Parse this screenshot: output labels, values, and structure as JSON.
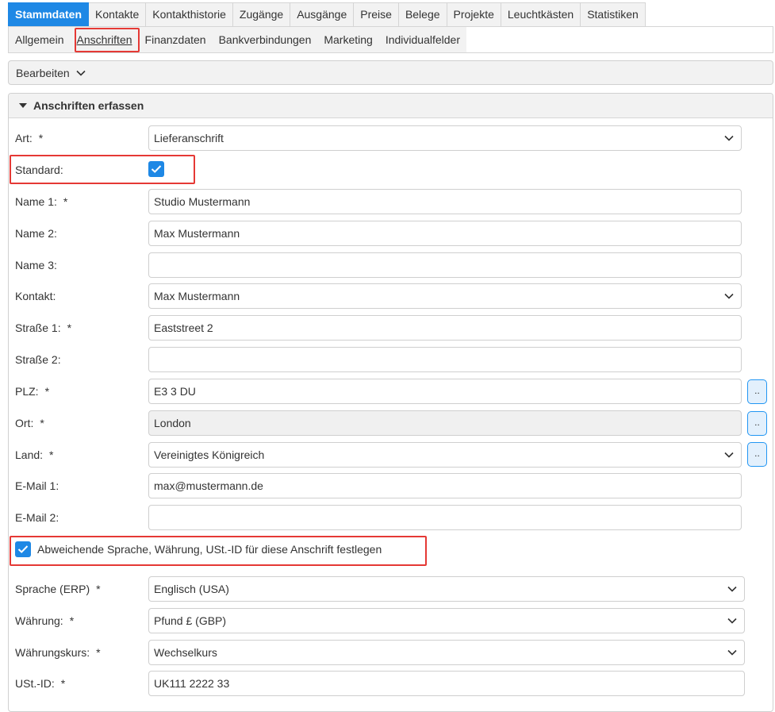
{
  "tabs_main": [
    "Stammdaten",
    "Kontakte",
    "Kontakthistorie",
    "Zugänge",
    "Ausgänge",
    "Preise",
    "Belege",
    "Projekte",
    "Leuchtkästen",
    "Statistiken"
  ],
  "tabs_sub": [
    "Allgemein",
    "Anschriften",
    "Finanzdaten",
    "Bankverbindungen",
    "Marketing",
    "Individualfelder"
  ],
  "edit_menu": {
    "label": "Bearbeiten"
  },
  "section": {
    "title": "Anschriften erfassen"
  },
  "required_mark": "*",
  "dots_label": "..",
  "form": {
    "art": {
      "label": "Art:",
      "value": "Lieferanschrift"
    },
    "standard": {
      "label": "Standard:",
      "checked": true
    },
    "name1": {
      "label": "Name 1:",
      "value": "Studio Mustermann"
    },
    "name2": {
      "label": "Name 2:",
      "value": "Max Mustermann"
    },
    "name3": {
      "label": "Name 3:",
      "value": ""
    },
    "kontakt": {
      "label": "Kontakt:",
      "value": "Max Mustermann"
    },
    "strasse1": {
      "label": "Straße 1:",
      "value": "Eaststreet 2"
    },
    "strasse2": {
      "label": "Straße 2:",
      "value": ""
    },
    "plz": {
      "label": "PLZ:",
      "value": "E3 3 DU"
    },
    "ort": {
      "label": "Ort:",
      "value": "London"
    },
    "land": {
      "label": "Land:",
      "value": "Vereinigtes Königreich"
    },
    "email1": {
      "label": "E-Mail 1:",
      "value": "max@mustermann.de"
    },
    "email2": {
      "label": "E-Mail 2:",
      "value": ""
    },
    "abweichend": {
      "label": "Abweichende Sprache, Währung, USt.-ID für diese Anschrift festlegen",
      "checked": true
    },
    "sprache": {
      "label": "Sprache (ERP)",
      "value": "Englisch (USA)"
    },
    "waehrung": {
      "label": "Währung:",
      "value": "Pfund £ (GBP)"
    },
    "waehrungskurs": {
      "label": "Währungskurs:",
      "value": "Wechselkurs"
    },
    "ustid": {
      "label": "USt.-ID:",
      "value": "UK111 2222 33"
    }
  },
  "colors": {
    "accent": "#1e88e5",
    "highlight": "#e53935"
  }
}
